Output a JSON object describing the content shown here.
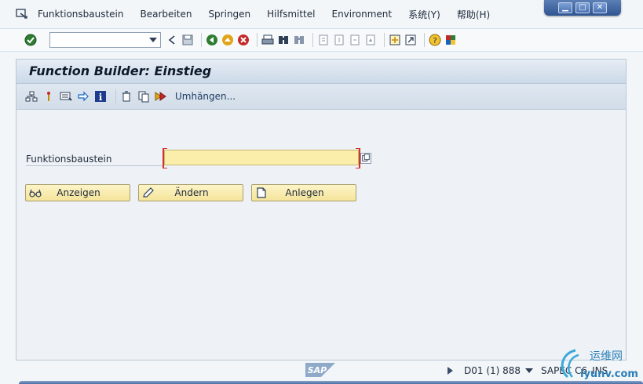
{
  "window": {
    "min_glyph": "▁",
    "max_glyph": "□",
    "close_glyph": "✕"
  },
  "menubar": {
    "items": [
      {
        "label": "Funktionsbaustein"
      },
      {
        "label": "Bearbeiten"
      },
      {
        "label": "Springen"
      },
      {
        "label": "Hilfsmittel"
      },
      {
        "label": "Environment"
      },
      {
        "label": "系统(Y)"
      },
      {
        "label": "帮助(H)"
      }
    ]
  },
  "toolbar": {
    "command_field": {
      "value": "",
      "placeholder": ""
    }
  },
  "screen": {
    "title": "Function Builder: Einstieg",
    "app_toolbar": {
      "reassign_label": "Umhängen..."
    },
    "field": {
      "label": "Funktionsbaustein",
      "value": ""
    },
    "buttons": {
      "display": "Anzeigen",
      "change": "Ändern",
      "create": "Anlegen"
    }
  },
  "status_bar": {
    "logo_text": "SAP",
    "system": "D01 (1) 888",
    "program": "SAPEC C6",
    "mode": "INS"
  },
  "watermark": {
    "text": "运维网",
    "sub": "iyunv.com"
  },
  "colors": {
    "input_bg": "#fbeeaa",
    "button_bg": "#f5e49a",
    "required_marker": "#d0342c",
    "title_bar": "#cbd9e8"
  }
}
